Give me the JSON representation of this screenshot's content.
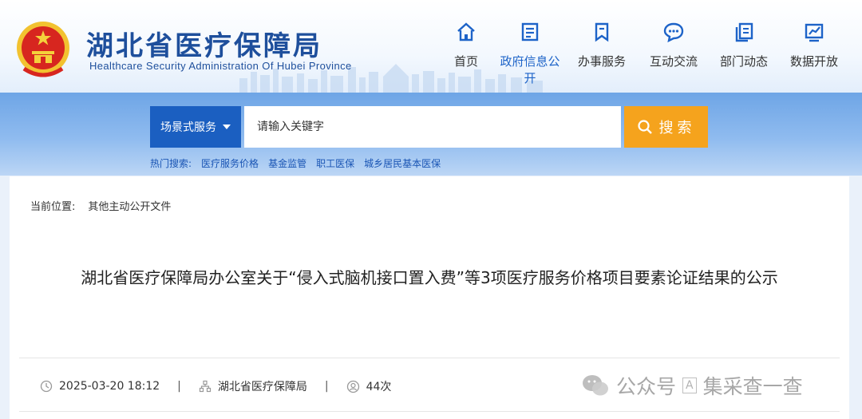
{
  "header": {
    "site_title": "湖北省医疗保障局",
    "site_subtitle": "Healthcare Security Administration Of Hubei Province",
    "nav": [
      {
        "label": "首页",
        "icon": "home-icon",
        "active": false
      },
      {
        "label": "政府信息公开",
        "icon": "document-icon",
        "active": true
      },
      {
        "label": "办事服务",
        "icon": "bookmark-icon",
        "active": false
      },
      {
        "label": "互动交流",
        "icon": "chat-icon",
        "active": false
      },
      {
        "label": "部门动态",
        "icon": "copy-icon",
        "active": false
      },
      {
        "label": "数据开放",
        "icon": "chart-icon",
        "active": false
      }
    ]
  },
  "search": {
    "scene_label": "场景式服务",
    "placeholder": "请输入关键字",
    "button_label": "搜索",
    "hot_label": "热门搜索:",
    "hot_terms": [
      "医疗服务价格",
      "基金监管",
      "职工医保",
      "城乡居民基本医保"
    ]
  },
  "breadcrumb": {
    "label": "当前位置:",
    "current": "其他主动公开文件"
  },
  "article": {
    "title": "湖北省医疗保障局办公室关于“侵入式脑机接口置入费”等3项医疗服务价格项目要素论证结果的公示",
    "date": "2025-03-20 18:12",
    "publisher": "湖北省医疗保障局",
    "views": "44次"
  },
  "watermark": {
    "text1": "公众号",
    "badge": "A",
    "text2": "集采查一查"
  },
  "colors": {
    "brand_blue": "#1e4f9c",
    "active_nav": "#1d63c8",
    "select_bg": "#1b5fc1",
    "search_button": "#f5a31d"
  }
}
